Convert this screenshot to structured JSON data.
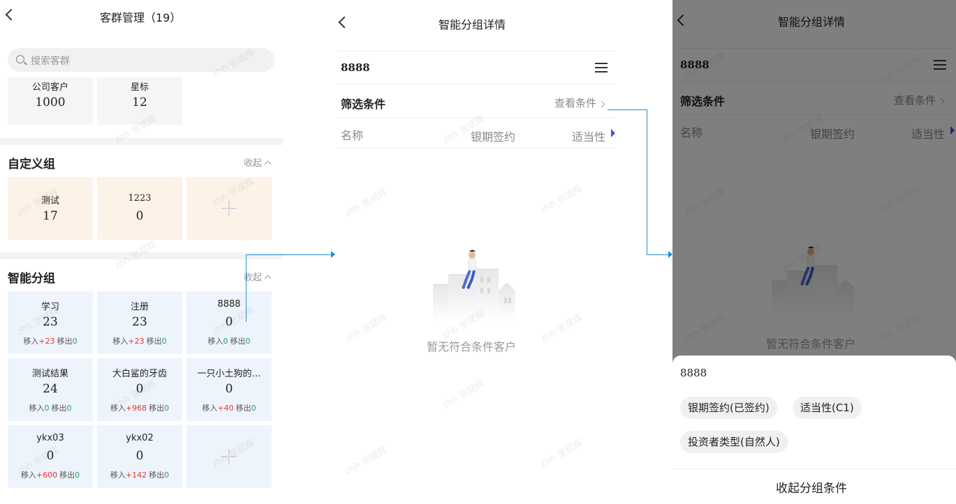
{
  "p1": {
    "title": "客群管理（19）",
    "search_placeholder": "搜索客群",
    "top_cards": [
      {
        "name": "公司客户",
        "value": "1000"
      },
      {
        "name": "星标",
        "value": "12"
      }
    ],
    "custom_section": {
      "title": "自定义组",
      "collapse": "收起"
    },
    "custom_cards": [
      {
        "name": "测试",
        "value": "17"
      },
      {
        "name": "1223",
        "value": "0"
      }
    ],
    "smart_section": {
      "title": "智能分组",
      "collapse": "收起"
    },
    "smart_cards": [
      {
        "name": "学习",
        "value": "23",
        "in_label": "移入",
        "in": "+23",
        "out_label": "移出",
        "out": "0"
      },
      {
        "name": "注册",
        "value": "23",
        "in_label": "移入",
        "in": "+23",
        "out_label": "移出",
        "out": "0"
      },
      {
        "name": "8888",
        "value": "0",
        "in_label": "移入",
        "in": "0",
        "out_label": "移出",
        "out": "0"
      },
      {
        "name": "测试结果",
        "value": "24",
        "in_label": "移入",
        "in": "0",
        "out_label": "移出",
        "out": "0"
      },
      {
        "name": "大白鲨的牙齿",
        "value": "0",
        "in_label": "移入",
        "in": "+968",
        "out_label": "移出",
        "out": "0"
      },
      {
        "name": "一只小土狗的…",
        "value": "0",
        "in_label": "移入",
        "in": "+40",
        "out_label": "移出",
        "out": "0"
      },
      {
        "name": "ykx03",
        "value": "0",
        "in_label": "移入",
        "in": "+600",
        "out_label": "移出",
        "out": "0"
      },
      {
        "name": "ykx02",
        "value": "0",
        "in_label": "移入",
        "in": "+142",
        "out_label": "移出",
        "out": "0"
      }
    ]
  },
  "p2": {
    "title": "智能分组详情",
    "group_name": "8888",
    "filter_label": "筛选条件",
    "view_label": "查看条件",
    "cols": [
      "名称",
      "银期签约",
      "适当性"
    ],
    "empty": "暂无符合条件客户"
  },
  "p3": {
    "title": "智能分组详情",
    "group_name": "8888",
    "filter_label": "筛选条件",
    "view_label": "查看条件",
    "cols": [
      "名称",
      "银期签约",
      "适当性"
    ],
    "empty": "暂无符合条件客户",
    "sheet": {
      "name": "8888",
      "tags": [
        "银期签约(已签约)",
        "适当性(C1)",
        "投资者类型(自然人)"
      ],
      "collapse": "收起分组条件"
    }
  },
  "watermark": "zhh 张斌辉",
  "colors": {
    "accent_line": "#1e90d6",
    "in_red": "#ee3333",
    "out_green": "#2a9d58",
    "peach": "#fdf2e8",
    "blue_card": "#eef4fb"
  },
  "icons": [
    "back-arrow-icon",
    "search-icon",
    "chevron-up-icon",
    "plus-icon",
    "menu-icon",
    "chevron-right-icon",
    "triangle-right-icon",
    "empty-illustration-icon"
  ]
}
